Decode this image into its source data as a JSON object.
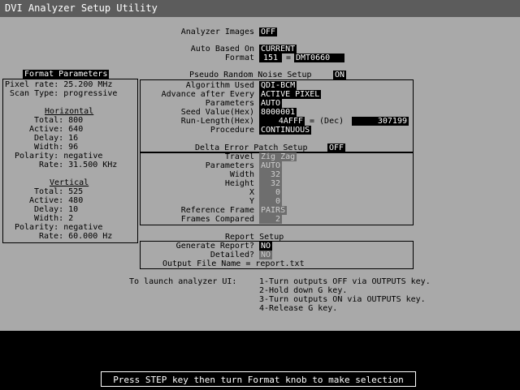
{
  "title": "DVI Analyzer Setup Utility",
  "analyzer_images": {
    "label": "Analyzer Images",
    "value": "OFF"
  },
  "auto_based_on": {
    "label": "Auto Based On",
    "value": "CURRENT"
  },
  "format": {
    "label": "Format",
    "value": "151",
    "eq": "=",
    "name": "DMT0660"
  },
  "format_params": {
    "header": "Format Parameters",
    "pixel_rate": "Pixel rate: 25.200 MHz",
    "scan_type": "Scan Type: progressive",
    "horizontal": {
      "title": "Horizontal",
      "total": "Total: 800",
      "active": "Active: 640",
      "delay": "Delay: 16",
      "width": "Width: 96",
      "polarity": "Polarity: negative",
      "rate": "Rate: 31.500 KHz"
    },
    "vertical": {
      "title": "Vertical",
      "total": "Total: 525",
      "active": "Active: 480",
      "delay": "Delay: 10",
      "width": "Width: 2",
      "polarity": "Polarity: negative",
      "rate": "Rate: 60.000 Hz"
    }
  },
  "prn": {
    "title": "Pseudo Random Noise Setup",
    "state": "ON",
    "algorithm_label": "Algorithm Used",
    "algorithm": "QDI-BCM",
    "advance_label": "Advance after Every",
    "advance": "ACTIVE PIXEL",
    "parameters_label": "Parameters",
    "parameters": "AUTO",
    "seed_label": "Seed Value(Hex)",
    "seed": "8000001",
    "runlength_label": "Run-Length(Hex)",
    "runlength": "4AFFF",
    "dec_label": "= (Dec)",
    "dec": "307199",
    "procedure_label": "Procedure",
    "procedure": "CONTINUOUS"
  },
  "delta": {
    "title": "Delta Error Patch Setup",
    "state": "OFF",
    "travel_label": "Travel",
    "travel": "Zig Zag",
    "parameters_label": "Parameters",
    "parameters": "AUTO",
    "width_label": "Width",
    "width": "32",
    "height_label": "Height",
    "height": "32",
    "x_label": "X",
    "x": "0",
    "y_label": "Y",
    "y": "0",
    "ref_label": "Reference Frame",
    "ref": "PAIRS",
    "frames_label": "Frames Compared",
    "frames": "2"
  },
  "report": {
    "title": "Report Setup",
    "generate_label": "Generate Report?",
    "generate": "NO",
    "detailed_label": "Detailed?",
    "detailed": "NO",
    "file_label": "Output File Name = report.txt"
  },
  "instructions": {
    "lead": "To launch analyzer UI:",
    "steps": [
      "1-Turn outputs OFF via OUTPUTS key.",
      "2-Hold down G key.",
      "3-Turn outputs ON via OUTPUTS key.",
      "4-Release G key."
    ]
  },
  "status": "Press STEP key then turn Format knob to make selection"
}
